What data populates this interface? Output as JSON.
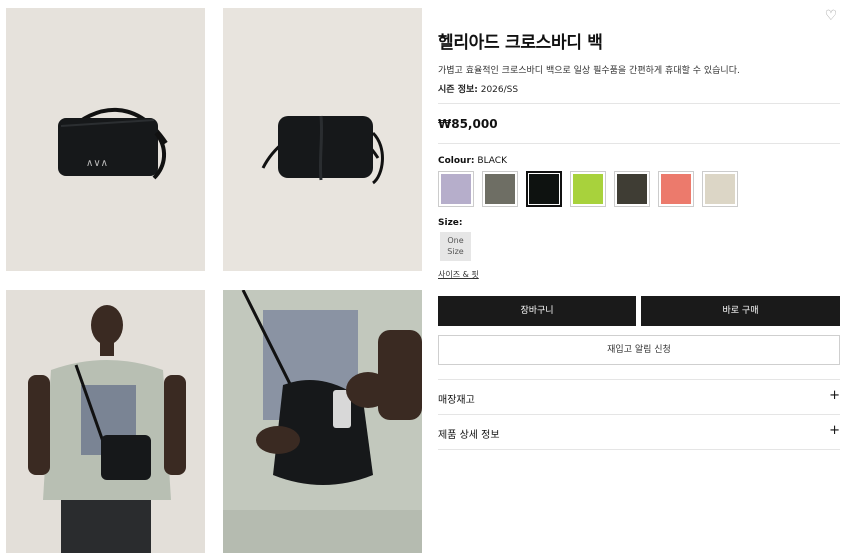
{
  "product": {
    "title": "헬리아드 크로스바디 백",
    "description": "가볍고 효율적인 크로스바디 백으로 일상 필수품을 간편하게 휴대할 수 있습니다.",
    "season_label": "시즌 정보:",
    "season_value": "2026/SS",
    "price": "₩85,000"
  },
  "colour": {
    "label": "Colour:",
    "selected": "BLACK",
    "swatches": [
      {
        "name": "lavender",
        "color": "#b6aecb"
      },
      {
        "name": "olive-grey",
        "color": "#6e6e64"
      },
      {
        "name": "black",
        "color": "#0e1210",
        "selected": true
      },
      {
        "name": "lime",
        "color": "#a8d23c"
      },
      {
        "name": "black-olive",
        "color": "#3f3d34"
      },
      {
        "name": "coral",
        "color": "#ec7a6c"
      },
      {
        "name": "beige",
        "color": "#dcd6c6"
      }
    ]
  },
  "size": {
    "label": "Size:",
    "option_line1": "One",
    "option_line2": "Size",
    "guide_link": "사이즈 & 핏"
  },
  "actions": {
    "cart": "장바구니",
    "buy_now": "바로 구매",
    "restock_alert": "재입고 알림 신청"
  },
  "accordion": {
    "store_stock": "매장재고",
    "product_details": "제품 상세 정보",
    "expand_symbol": "+"
  },
  "icons": {
    "wishlist": "heart-icon",
    "wishlist_glyph": "♡"
  }
}
